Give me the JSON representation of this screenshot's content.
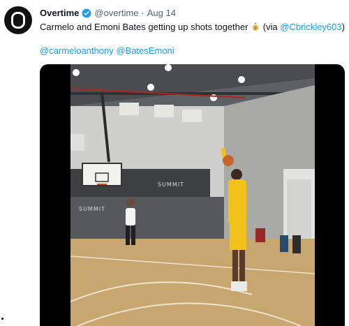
{
  "tweet": {
    "display_name": "Overtime",
    "handle": "@overtime",
    "separator": "·",
    "date": "Aug 14",
    "text_before": "Carmelo and Emoni Bates getting up shots together",
    "text_via_open": "(via ",
    "via_mention": "@Cbrickley603",
    "text_via_close": ")",
    "mention_1": "@carmeloanthony",
    "mention_2": "@BatesEmoni",
    "gym_sign_1": "SUMMIT",
    "gym_sign_2": "SUMMIT"
  },
  "icons": {
    "avatar": "overtime-logo",
    "verified": "verified-badge-icon",
    "emoji": "money-bag-icon"
  },
  "colors": {
    "link": "#1d9bf0",
    "secondary_text": "#536471",
    "jersey_yellow": "#f2c21a"
  }
}
